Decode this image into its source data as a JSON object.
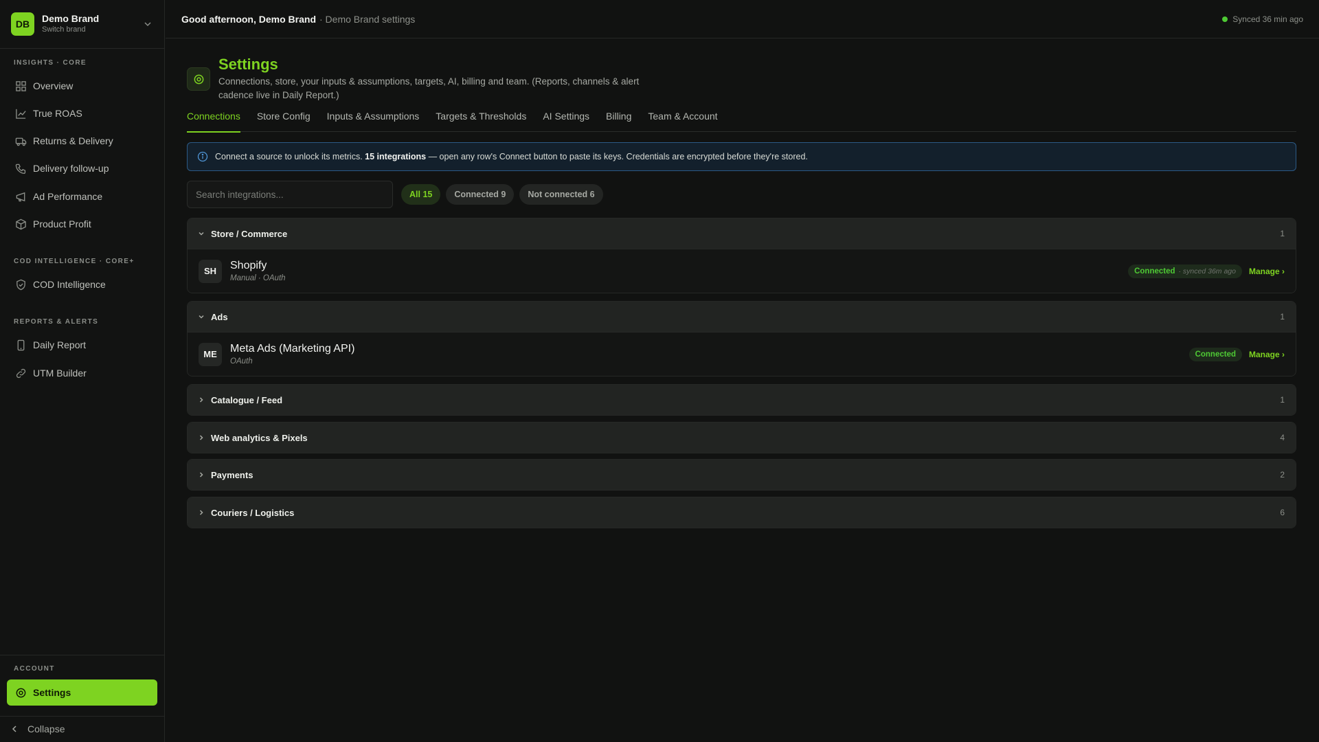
{
  "brand": {
    "initials": "DB",
    "name": "Demo Brand",
    "sub": "Switch brand"
  },
  "sidebar": {
    "sections": [
      {
        "title": "INSIGHTS · CORE"
      },
      {
        "title": "COD INTELLIGENCE · CORE+"
      },
      {
        "title": "REPORTS & ALERTS"
      },
      {
        "title": "ACCOUNT"
      }
    ],
    "items": [
      {
        "label": "Overview",
        "icon": "grid-icon"
      },
      {
        "label": "True ROAS",
        "icon": "chart-line-icon"
      },
      {
        "label": "Returns & Delivery",
        "icon": "truck-icon"
      },
      {
        "label": "Delivery follow-up",
        "icon": "phone-icon"
      },
      {
        "label": "Ad Performance",
        "icon": "megaphone-icon"
      },
      {
        "label": "Product Profit",
        "icon": "box-icon"
      },
      {
        "label": "COD Intelligence",
        "icon": "shield-check-icon"
      },
      {
        "label": "Daily Report",
        "icon": "device-icon"
      },
      {
        "label": "UTM Builder",
        "icon": "link-icon"
      },
      {
        "label": "Settings",
        "icon": "gear-icon"
      }
    ],
    "collapse_label": "Collapse"
  },
  "topbar": {
    "greeting": "Good afternoon, Demo Brand",
    "subtitle": "· Demo Brand settings",
    "sync": "Synced 36 min ago"
  },
  "page": {
    "title": "Settings",
    "description": "Connections, store, your inputs & assumptions, targets, AI, billing and team. (Reports, channels & alert cadence live in Daily Report.)"
  },
  "tabs": [
    {
      "label": "Connections"
    },
    {
      "label": "Store Config"
    },
    {
      "label": "Inputs & Assumptions"
    },
    {
      "label": "Targets & Thresholds"
    },
    {
      "label": "AI Settings"
    },
    {
      "label": "Billing"
    },
    {
      "label": "Team & Account"
    }
  ],
  "banner": {
    "pre": "Connect a source to unlock its metrics.",
    "bold": "15 integrations",
    "post": "— open any row's Connect button to paste its keys. Credentials are encrypted before they're stored."
  },
  "search": {
    "placeholder": "Search integrations..."
  },
  "filters": [
    {
      "label": "All 15"
    },
    {
      "label": "Connected 9"
    },
    {
      "label": "Not connected 6"
    }
  ],
  "groups": [
    {
      "title": "Store / Commerce",
      "count": "1",
      "expanded": true,
      "rows": [
        {
          "initials": "SH",
          "name": "Shopify",
          "meta": "Manual · OAuth",
          "status": "Connected",
          "status_meta": "· synced 36m ago",
          "action": "Manage ›"
        }
      ]
    },
    {
      "title": "Ads",
      "count": "1",
      "expanded": true,
      "rows": [
        {
          "initials": "ME",
          "name": "Meta Ads (Marketing API)",
          "meta": "OAuth",
          "status": "Connected",
          "status_meta": "",
          "action": "Manage ›"
        }
      ]
    },
    {
      "title": "Catalogue / Feed",
      "count": "1",
      "expanded": false
    },
    {
      "title": "Web analytics & Pixels",
      "count": "4",
      "expanded": false
    },
    {
      "title": "Payments",
      "count": "2",
      "expanded": false
    },
    {
      "title": "Couriers / Logistics",
      "count": "6",
      "expanded": false
    }
  ],
  "colors": {
    "accent": "#7ed321",
    "connected": "#4ec934",
    "info_border": "#2c5a86"
  }
}
